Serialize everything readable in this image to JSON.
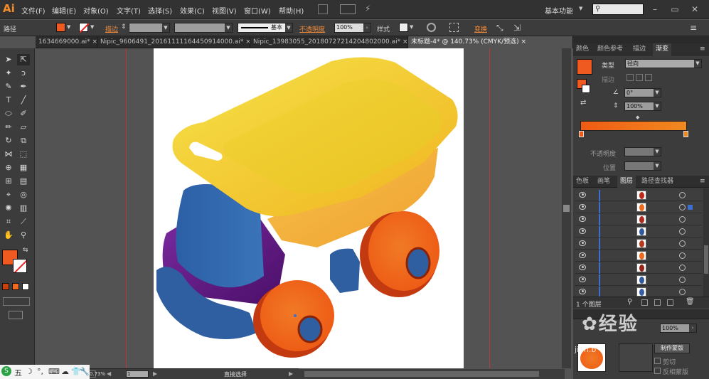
{
  "app": {
    "logo": "Ai"
  },
  "menubar": {
    "items": [
      "文件(F)",
      "编辑(E)",
      "对象(O)",
      "文字(T)",
      "选择(S)",
      "效果(C)",
      "视图(V)",
      "窗口(W)",
      "帮助(H)"
    ],
    "workspace": "基本功能",
    "search_placeholder": ""
  },
  "control_bar": {
    "selection_label": "路径",
    "stroke_label": "描边",
    "stroke_style": "基本",
    "opacity_label": "不透明度",
    "opacity_value": "100%",
    "style_label": "样式",
    "transform_label": "变换",
    "fill_color": "#ee5a1f"
  },
  "tabs": [
    {
      "label": "1634669000.ai* ×",
      "active": false
    },
    {
      "label": "Nipic_9606491_20161111164450914000.ai* ×",
      "active": false
    },
    {
      "label": "Nipic_13983055_20180727214204802000.ai* ×",
      "active": false
    },
    {
      "label": "未标题-4* @ 140.73% (CMYK/预选) ×",
      "active": true
    }
  ],
  "tools": {
    "fill_color": "#ee5a1f"
  },
  "status": {
    "zoom": "140.73%",
    "page": "1",
    "tool_name": "直接选择"
  },
  "gradient_panel": {
    "tabs": [
      "颜色",
      "颜色参考",
      "描边",
      "渐变"
    ],
    "type_label": "类型",
    "type_value": "径向",
    "stroke_label": "描边",
    "angle_value": "0°",
    "aspect_value": "100%",
    "opacity_label": "不透明度",
    "position_label": "位置",
    "gradient_start": "#f05a14",
    "gradient_end": "#f08a20"
  },
  "layers_panel": {
    "tabs": [
      "色板",
      "画笔",
      "图层",
      "路径查找器"
    ],
    "count_label": "1 个图层",
    "rows": [
      {
        "color": "#c0281a"
      },
      {
        "color": "#f06a1c"
      },
      {
        "color": "#b02a1e"
      },
      {
        "color": "#2f5aa0"
      },
      {
        "color": "#b83a1e"
      },
      {
        "color": "#ee6a1e"
      },
      {
        "color": "#9a2418"
      },
      {
        "color": "#2f5aa0"
      },
      {
        "color": "#3a5ea8"
      }
    ]
  },
  "transparency_panel": {
    "opacity_value": "100%",
    "make_mask_button": "制作蒙版",
    "clip_label": "剪切",
    "invert_mask_label": "反相蒙版"
  },
  "taskbar": {
    "items": [
      "S",
      "五",
      "☽",
      "°,",
      "⌨",
      "☁",
      "👕",
      "🔧"
    ]
  },
  "watermark": {
    "text": "经验",
    "sub": "jian.b"
  }
}
